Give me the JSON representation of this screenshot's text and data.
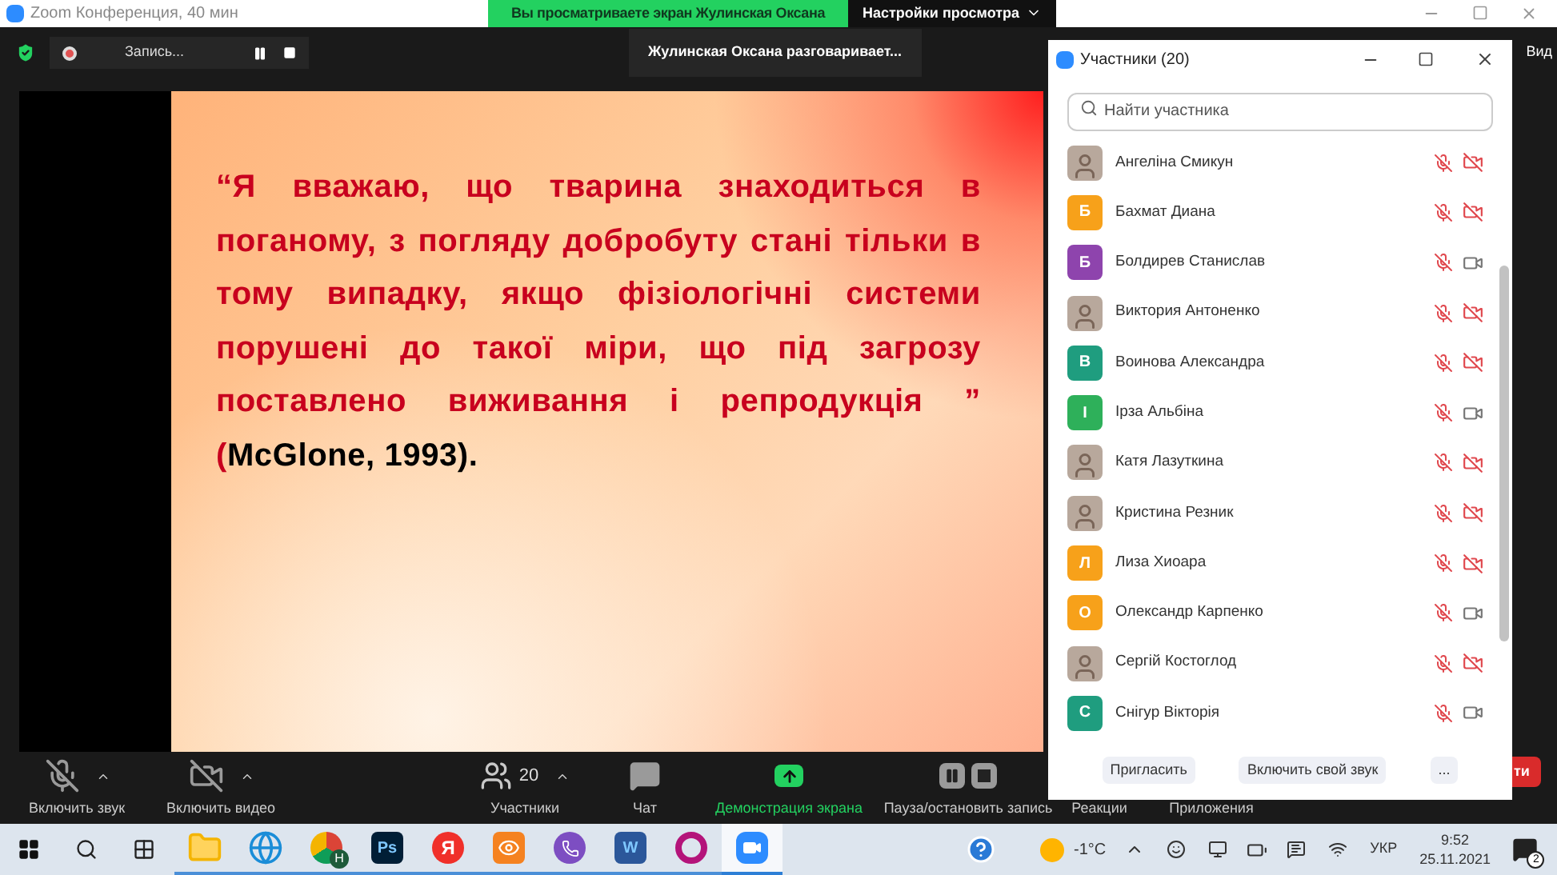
{
  "window": {
    "title": "Zoom Конференция, 40 мин"
  },
  "banner": {
    "text": "Вы просматриваете экран Жулинская Оксана",
    "view_settings": "Настройки просмотра"
  },
  "recording": {
    "label": "Запись..."
  },
  "speaker_notice": "Жулинская Оксана разговаривает...",
  "view_label": "Вид",
  "slide": {
    "quote": "“Я вважаю, що тварина знаходиться в поганому, з погляду добробуту стані тільки в тому випадку, якщо фізіологічні системи порушені до такої міри, що під загрозу поставлено виживання і репродукція ” (**McGlone, 1993).**"
  },
  "participants_panel": {
    "title": "Участники (20)",
    "search": {
      "placeholder": "Найти участника"
    },
    "participants": [
      {
        "name": "Ангеліна Смикун",
        "kind": "photo",
        "mic_muted": true,
        "video_off": true
      },
      {
        "name": "Бахмат Диана",
        "kind": "letter",
        "letter": "Б",
        "color": "#f7a11a",
        "mic_muted": true,
        "video_off": true
      },
      {
        "name": "Болдирев Станислав",
        "kind": "letter",
        "letter": "Б",
        "color": "#8e44ad",
        "mic_muted": true,
        "video_off": false
      },
      {
        "name": "Виктория Антоненко",
        "kind": "photo",
        "mic_muted": true,
        "video_off": true
      },
      {
        "name": "Воинова Александра",
        "kind": "letter",
        "letter": "В",
        "color": "#1f9d7f",
        "mic_muted": true,
        "video_off": true
      },
      {
        "name": "Ірза Альбіна",
        "kind": "letter",
        "letter": "І",
        "color": "#2eb05a",
        "mic_muted": true,
        "video_off": false
      },
      {
        "name": "Катя Лазуткина",
        "kind": "photo",
        "mic_muted": true,
        "video_off": true
      },
      {
        "name": "Кристина Резник",
        "kind": "photo",
        "mic_muted": true,
        "video_off": true
      },
      {
        "name": "Лиза Хиоара",
        "kind": "letter",
        "letter": "Л",
        "color": "#f7a11a",
        "mic_muted": true,
        "video_off": true
      },
      {
        "name": "Олександр Карпенко",
        "kind": "letter",
        "letter": "О",
        "color": "#f7a11a",
        "mic_muted": true,
        "video_off": false
      },
      {
        "name": "Сергій Костоглод",
        "kind": "photo",
        "mic_muted": true,
        "video_off": true
      },
      {
        "name": "Снігур Вікторія",
        "kind": "letter",
        "letter": "С",
        "color": "#1f9d7f",
        "mic_muted": true,
        "video_off": false
      }
    ],
    "buttons": [
      "Пригласить",
      "Включить свой звук",
      "..."
    ]
  },
  "toolbar": [
    {
      "kind": "mic",
      "label": "Включить звук",
      "muted": true
    },
    {
      "kind": "video",
      "label": "Включить видео",
      "muted": true
    },
    {
      "kind": "participants",
      "label": "Участники",
      "count": "20"
    },
    {
      "kind": "chat",
      "label": "Чат"
    },
    {
      "kind": "share",
      "label": "Демонстрация экрана"
    },
    {
      "kind": "record",
      "label": "Пауза/остановить запись"
    },
    {
      "kind": "reactions",
      "label": "Реакции"
    },
    {
      "kind": "apps",
      "label": "Приложения"
    }
  ],
  "end_button": "ти",
  "taskbar": {
    "apps": [
      {
        "kind": "folder",
        "active": false
      },
      {
        "kind": "edge",
        "active": false
      },
      {
        "kind": "chrome",
        "text": "H",
        "active": false
      },
      {
        "kind": "tile",
        "text": "Ps",
        "color": "#001e36",
        "active": false
      },
      {
        "kind": "round",
        "text": "Я",
        "color": "#f0302a",
        "active": false
      },
      {
        "kind": "incognito",
        "color": "#f58220",
        "active": false
      },
      {
        "kind": "viber",
        "color": "#7d4ec2",
        "active": false
      },
      {
        "kind": "tile",
        "text": "W",
        "color": "#2b579a",
        "active": false
      },
      {
        "kind": "opera",
        "color": "#b4147a",
        "active": false
      },
      {
        "kind": "zoom",
        "color": "#2d8cff",
        "active": true
      }
    ],
    "temperature": "-1°C",
    "language": "УКР",
    "time": "9:52",
    "date": "25.11.2021",
    "notifications": "2"
  }
}
